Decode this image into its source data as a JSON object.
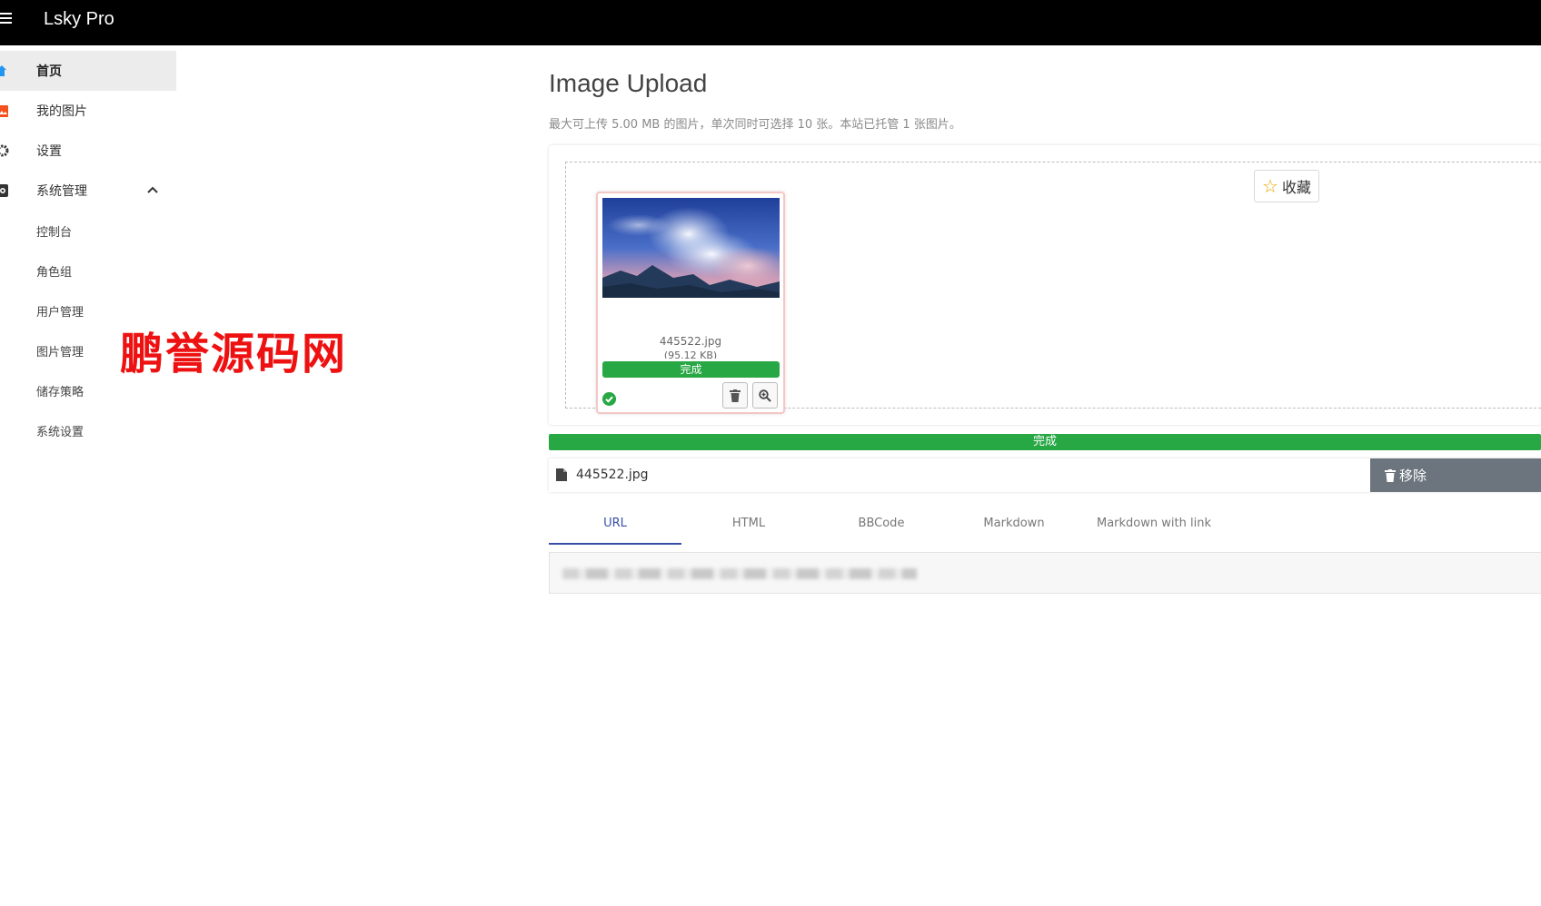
{
  "app": {
    "title": "Lsky Pro"
  },
  "sidebar": {
    "items": [
      {
        "label": "首页",
        "icon": "home-icon",
        "active": true
      },
      {
        "label": "我的图片",
        "icon": "image-icon"
      },
      {
        "label": "设置",
        "icon": "gear-icon"
      },
      {
        "label": "系统管理",
        "icon": "admin-icon",
        "expanded": true
      }
    ],
    "subitems": [
      {
        "label": "控制台"
      },
      {
        "label": "角色组"
      },
      {
        "label": "用户管理"
      },
      {
        "label": "图片管理"
      },
      {
        "label": "储存策略"
      },
      {
        "label": "系统设置"
      }
    ]
  },
  "watermark": {
    "text": "鹏誉源码网",
    "color": "#ee1111"
  },
  "upload": {
    "title": "Image Upload",
    "description": "最大可上传 5.00 MB 的图片，单次同时可选择 10 张。本站已托管 1 张图片。",
    "favorite_label": "收藏",
    "thumbnail": {
      "file_name": "445522.jpg",
      "file_size": "(95.12 KB)",
      "status": "完成",
      "progress": 1.0
    },
    "overall_status": "完成",
    "overall_progress": 1.0,
    "file_row": {
      "name": "445522.jpg",
      "remove_label": "移除"
    },
    "tabs": [
      {
        "label": "URL",
        "active": true
      },
      {
        "label": "HTML"
      },
      {
        "label": "BBCode"
      },
      {
        "label": "Markdown"
      },
      {
        "label": "Markdown with link"
      }
    ]
  },
  "colors": {
    "success": "#28a745",
    "active_tab": "#3a4ea8",
    "remove_button": "#6c757d",
    "home_icon": "#2196f3",
    "image_icon": "#f4511e"
  }
}
